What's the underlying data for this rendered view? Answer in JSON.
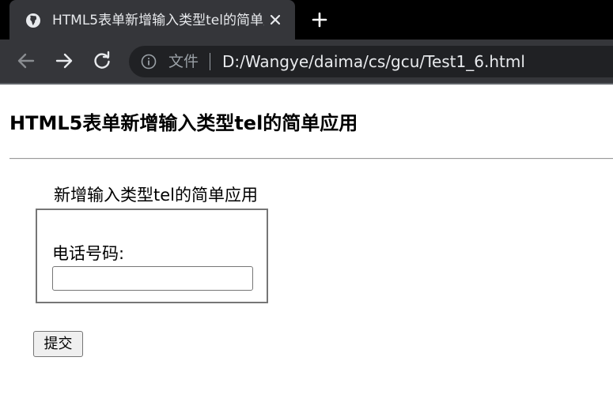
{
  "browser": {
    "tab": {
      "title": "HTML5表单新增输入类型tel的简单应用",
      "favicon": "globe-icon"
    },
    "new_tab_icon": "plus-icon",
    "nav": {
      "back_icon": "arrow-left-icon",
      "forward_icon": "arrow-right-icon",
      "reload_icon": "reload-icon"
    },
    "omnibox": {
      "info_icon": "info-icon",
      "scheme_label": "文件",
      "url": "D:/Wangye/daima/cs/gcu/Test1_6.html"
    },
    "colors": {
      "tabstrip": "#000000",
      "toolbar": "#35363a",
      "omnibox": "#202124"
    }
  },
  "page": {
    "heading": "HTML5表单新增输入类型tel的简单应用",
    "form": {
      "legend": "新增输入类型tel的简单应用",
      "phone_label": "电话号码:",
      "phone_value": "",
      "submit_label": "提交"
    }
  }
}
